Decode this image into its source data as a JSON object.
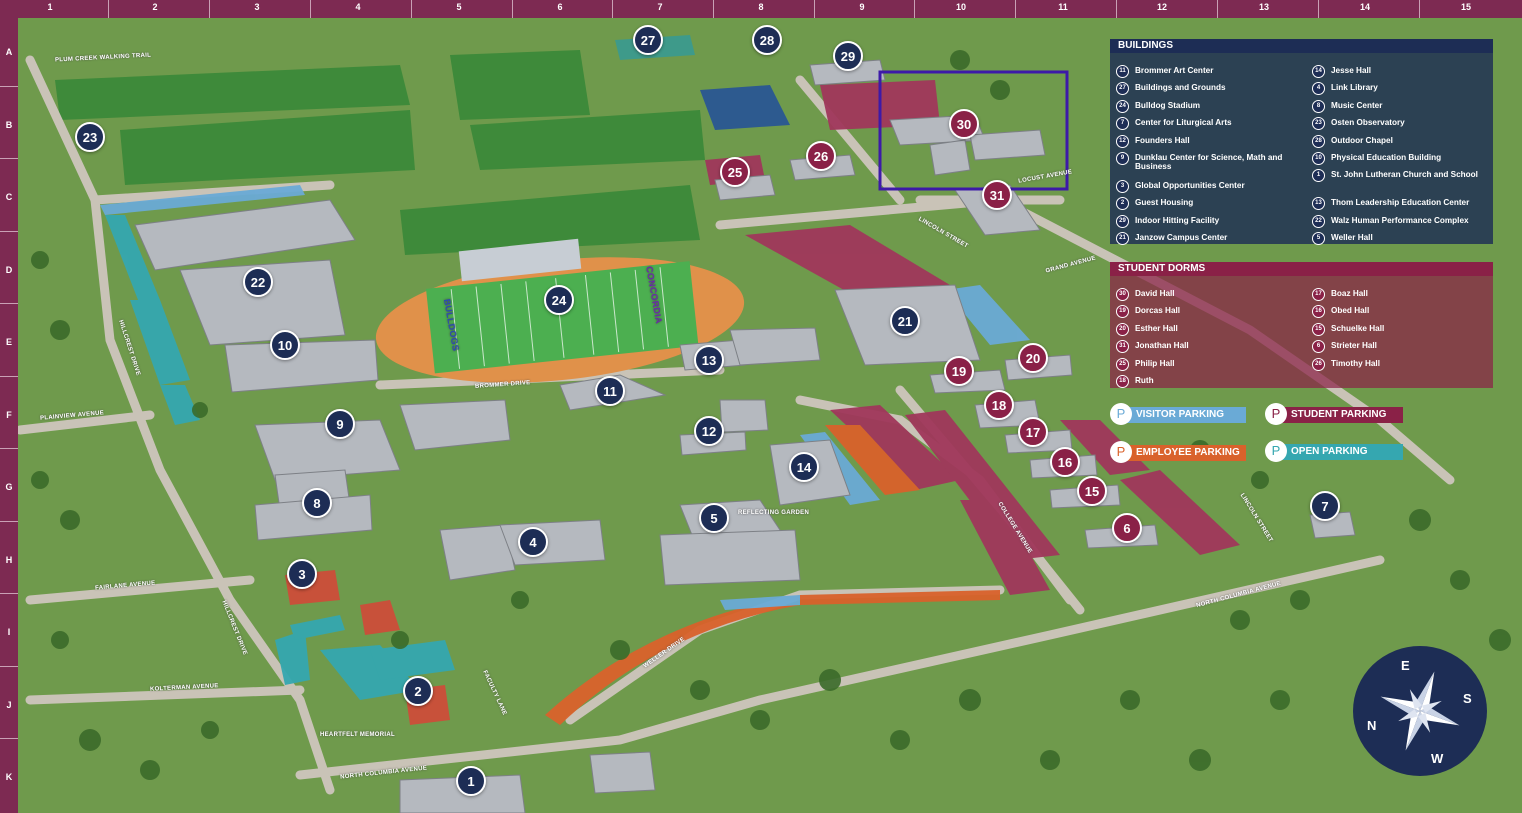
{
  "grid": {
    "columns": [
      "1",
      "2",
      "3",
      "4",
      "5",
      "6",
      "7",
      "8",
      "9",
      "10",
      "11",
      "12",
      "13",
      "14",
      "15"
    ],
    "rows": [
      "A",
      "B",
      "C",
      "D",
      "E",
      "F",
      "G",
      "H",
      "I",
      "J",
      "K"
    ]
  },
  "colors": {
    "frame": "#7d2a52",
    "building_marker": "#1d2d55",
    "dorm_marker": "#8a2147",
    "buildings_panel": "#1d2d55",
    "dorms_panel": "#8a2147",
    "visitor_parking": "#6aaad6",
    "student_parking": "#8a2147",
    "employee_parking": "#d9622b",
    "open_parking": "#35a7b0",
    "selection_box": "#3d1aa8"
  },
  "streets": [
    "PLUM CREEK WALKING TRAIL",
    "HILLCREST DRIVE",
    "PLAINVIEW AVENUE",
    "FAIRLANE AVENUE",
    "HILLCREST DRIVE",
    "KOLTERMAN AVENUE",
    "NORTH COLUMBIA AVENUE",
    "FACULTY LANE",
    "WELLER DRIVE",
    "BROMMER DRIVE",
    "COLLEGE AVENUE",
    "LINCOLN STREET",
    "LINCOLN STREET",
    "NORTH COLUMBIA AVENUE",
    "GRAND AVENUE",
    "LOCUST AVENUE",
    "REFLECTING GARDEN",
    "HEARTFELT MEMORIAL"
  ],
  "markers": [
    {
      "num": "27",
      "kind": "bld"
    },
    {
      "num": "28",
      "kind": "bld"
    },
    {
      "num": "29",
      "kind": "bld"
    },
    {
      "num": "30",
      "kind": "dorm"
    },
    {
      "num": "23",
      "kind": "bld"
    },
    {
      "num": "25",
      "kind": "dorm"
    },
    {
      "num": "26",
      "kind": "dorm"
    },
    {
      "num": "31",
      "kind": "dorm"
    },
    {
      "num": "22",
      "kind": "bld"
    },
    {
      "num": "24",
      "kind": "bld"
    },
    {
      "num": "21",
      "kind": "bld"
    },
    {
      "num": "10",
      "kind": "bld"
    },
    {
      "num": "13",
      "kind": "bld"
    },
    {
      "num": "19",
      "kind": "dorm"
    },
    {
      "num": "20",
      "kind": "dorm"
    },
    {
      "num": "11",
      "kind": "bld"
    },
    {
      "num": "18",
      "kind": "dorm"
    },
    {
      "num": "9",
      "kind": "bld"
    },
    {
      "num": "12",
      "kind": "bld"
    },
    {
      "num": "17",
      "kind": "dorm"
    },
    {
      "num": "14",
      "kind": "bld"
    },
    {
      "num": "16",
      "kind": "dorm"
    },
    {
      "num": "15",
      "kind": "dorm"
    },
    {
      "num": "8",
      "kind": "bld"
    },
    {
      "num": "7",
      "kind": "bld"
    },
    {
      "num": "5",
      "kind": "bld"
    },
    {
      "num": "4",
      "kind": "bld"
    },
    {
      "num": "6",
      "kind": "dorm"
    },
    {
      "num": "3",
      "kind": "bld"
    },
    {
      "num": "2",
      "kind": "bld"
    },
    {
      "num": "1",
      "kind": "bld"
    }
  ],
  "buildings_legend": {
    "title": "BUILDINGS",
    "items": [
      {
        "num": "11",
        "name": "Brommer Art Center"
      },
      {
        "num": "27",
        "name": "Buildings and Grounds"
      },
      {
        "num": "24",
        "name": "Bulldog Stadium"
      },
      {
        "num": "7",
        "name": "Center for Liturgical Arts"
      },
      {
        "num": "12",
        "name": "Founders Hall"
      },
      {
        "num": "9",
        "name": "Dunklau Center for Science, Math and Business"
      },
      {
        "num": "3",
        "name": "Global Opportunities Center"
      },
      {
        "num": "2",
        "name": "Guest Housing"
      },
      {
        "num": "29",
        "name": "Indoor Hitting Facility"
      },
      {
        "num": "21",
        "name": "Janzow Campus Center"
      },
      {
        "num": "14",
        "name": "Jesse Hall"
      },
      {
        "num": "4",
        "name": "Link Library"
      },
      {
        "num": "8",
        "name": "Music Center"
      },
      {
        "num": "23",
        "name": "Osten Observatory"
      },
      {
        "num": "28",
        "name": "Outdoor Chapel"
      },
      {
        "num": "10",
        "name": "Physical Education Building"
      },
      {
        "num": "1",
        "name": "St. John Lutheran Church and School"
      },
      {
        "num": "13",
        "name": "Thom Leadership Education Center"
      },
      {
        "num": "22",
        "name": "Walz Human Performance Complex"
      },
      {
        "num": "5",
        "name": "Weller Hall"
      }
    ]
  },
  "dorms_legend": {
    "title": "STUDENT DORMS",
    "items": [
      {
        "num": "30",
        "name": "David Hall"
      },
      {
        "num": "19",
        "name": "Dorcas Hall"
      },
      {
        "num": "20",
        "name": "Esther Hall"
      },
      {
        "num": "31",
        "name": "Jonathan Hall"
      },
      {
        "num": "25",
        "name": "Philip Hall"
      },
      {
        "num": "18",
        "name": "Ruth"
      },
      {
        "num": "17",
        "name": "Boaz Hall"
      },
      {
        "num": "16",
        "name": "Obed Hall"
      },
      {
        "num": "15",
        "name": "Schuelke Hall"
      },
      {
        "num": "6",
        "name": "Strieter Hall"
      },
      {
        "num": "26",
        "name": "Timothy Hall"
      }
    ]
  },
  "parking": {
    "symbol": "P",
    "visitor": "VISITOR PARKING",
    "student": "STUDENT PARKING",
    "employee": "EMPLOYEE PARKING",
    "open": "OPEN PARKING"
  },
  "stadium_text": {
    "left": "BULLDOGS",
    "right": "CONCORDIA"
  },
  "compass": {
    "e": "E",
    "s": "S",
    "w": "W",
    "n": "N"
  }
}
